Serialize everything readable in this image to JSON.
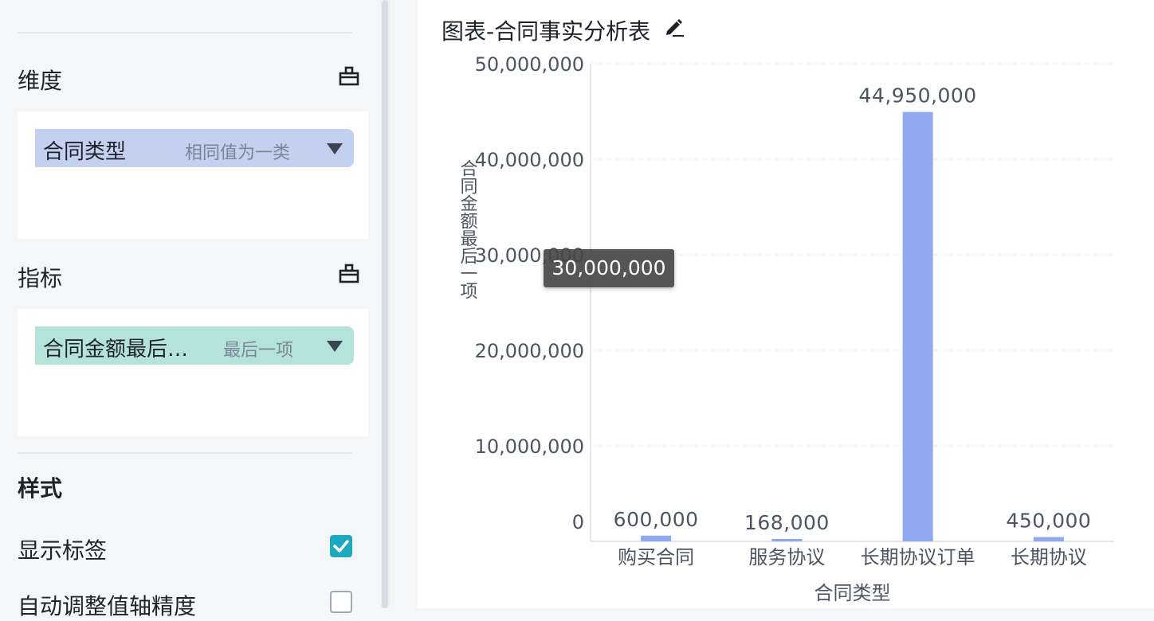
{
  "sidebar": {
    "dimension": {
      "label": "维度",
      "field": {
        "name": "合同类型",
        "agg": "相同值为一类",
        "color": "#c3d0f0"
      }
    },
    "measure": {
      "label": "指标",
      "field": {
        "name": "合同金额最后…",
        "agg": "最后一项",
        "color": "#b3e3da"
      }
    },
    "style": {
      "heading": "样式",
      "options": [
        {
          "label": "显示标签",
          "checked": true
        },
        {
          "label": "自动调整值轴精度",
          "checked": false
        }
      ]
    },
    "icons": {
      "add": "table-add-icon",
      "check": "checkmark-icon"
    }
  },
  "chart": {
    "title": "图表-合同事实分析表",
    "edit_icon": "edit-pen-icon",
    "tooltip": "30,000,000"
  },
  "chart_data": {
    "type": "bar",
    "categories": [
      "购买合同",
      "服务协议",
      "长期协议订单",
      "长期协议"
    ],
    "values": [
      600000,
      168000,
      44950000,
      450000
    ],
    "data_labels": [
      "600,000",
      "168,000",
      "44,950,000",
      "450,000"
    ],
    "title": "图表-合同事实分析表",
    "xlabel": "合同类型",
    "ylabel": "合同金额最后一项",
    "ylim": [
      0,
      50000000
    ],
    "yticks": [
      0,
      10000000,
      20000000,
      30000000,
      40000000,
      50000000
    ],
    "ytick_labels": [
      "0",
      "10,000,000",
      "20,000,000",
      "30,000,000",
      "40,000,000",
      "50,000,000"
    ],
    "grid": true,
    "bar_color": "#8fa8f0"
  }
}
